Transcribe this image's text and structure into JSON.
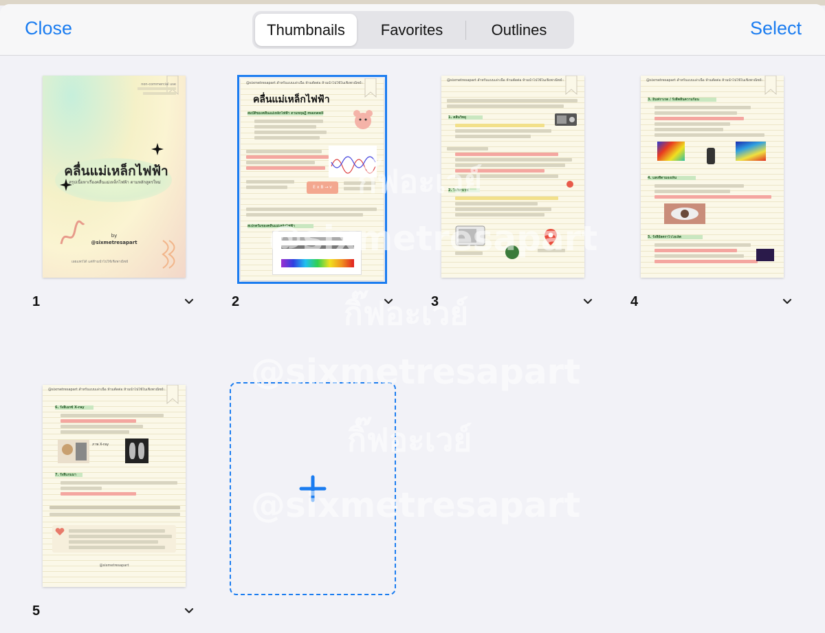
{
  "navbar": {
    "close_label": "Close",
    "select_label": "Select",
    "tabs": [
      {
        "label": "Thumbnails",
        "active": true
      },
      {
        "label": "Favorites",
        "active": false
      },
      {
        "label": "Outlines",
        "active": false
      }
    ]
  },
  "pages": [
    {
      "number": "1",
      "selected": false,
      "title": "คลื่นแม่เหล็กไฟฟ้า",
      "subtitle": "สรุปเนื้อหาเรื่องคลื่นแม่เหล็กไฟฟ้า ตามหลักสูตรใหม่",
      "by": "by",
      "author": "@sixmetresapart",
      "corner_note": "non-commercial use",
      "footer": "เผยแพร่ได้ แต่ห้ามนำไปใช้เชิงพาณิชย์"
    },
    {
      "number": "2",
      "selected": true,
      "header": "@sixmetresapart สำหรับแบบเล่าเนื้อ ห้ามตัดต่อ ห้ามนำไปใช้ในเชิงพาณิชย์ สรุปคุณครู",
      "title": "คลื่นแม่เหล็กไฟฟ้า",
      "section1": "สมบัติของคลื่นแม่เหล็กไฟฟ้า ตามทฤษฎี maxwell",
      "formula": "E x B → v",
      "section2": "สเปกตรัมของคลื่นแม่เหล็กไฟฟ้า"
    },
    {
      "number": "3",
      "selected": false,
      "header": "@sixmetresapart สำหรับแบบเล่าเนื้อ ห้ามตัดต่อ ห้ามนำไปใช้ในเชิงพาณิชย์ สรุปคุณครู",
      "section1": "1. คลื่นวิทยุ",
      "section2": "2. ไมโครเวฟ"
    },
    {
      "number": "4",
      "selected": false,
      "header": "@sixmetresapart สำหรับแบบเล่าเนื้อ ห้ามตัดต่อ ห้ามนำไปใช้ในเชิงพาณิชย์ สรุปคุณครู",
      "section1": "3. อินฟราเรด / รังสีคลื่นความร้อน",
      "section2": "4. แสงที่ตามองเห็น",
      "section3": "5. รังสีอัลตราไวโอเล็ต"
    },
    {
      "number": "5",
      "selected": false,
      "header": "@sixmetresapart สำหรับแบบเล่าเนื้อ ห้ามตัดต่อ ห้ามนำไปใช้ในเชิงพาณิชย์ สรุปคุณครู",
      "section1": "6. รังสีเอกซ์ X-ray",
      "section2": "7. รังสีแกมมา",
      "xray_label": "ภาพ X-ray",
      "footer": "@sixmetresapart"
    }
  ],
  "add_page": {
    "icon": "plus-icon"
  },
  "watermark": {
    "line1": "กิ๊ฟอะเวย์",
    "line2": "@sixmetresapart"
  },
  "colors": {
    "accent": "#1a7cf0",
    "background": "#f2f2f7"
  }
}
